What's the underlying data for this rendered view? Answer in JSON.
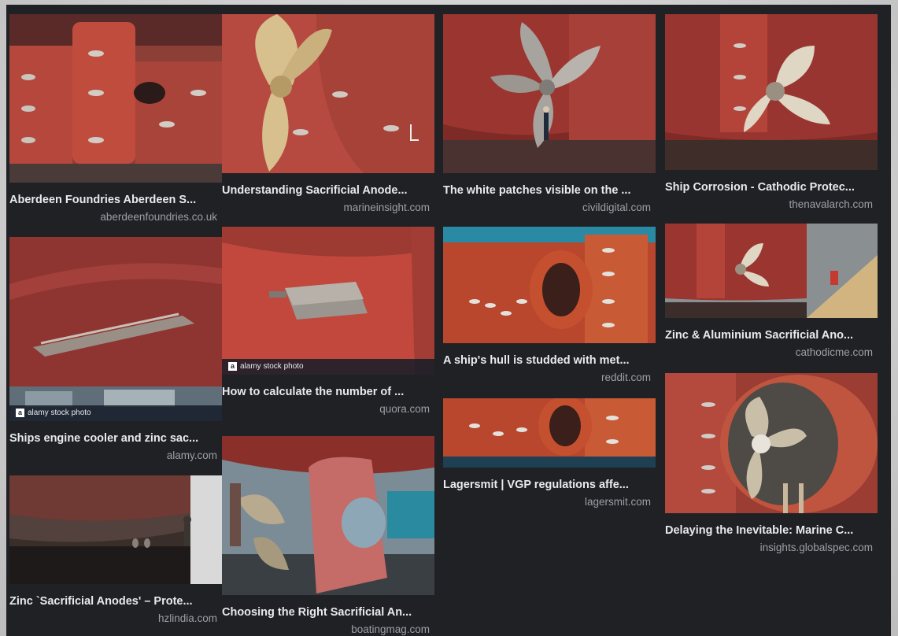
{
  "results": [
    {
      "caption": "Aberdeen Foundries Aberdeen S...",
      "source": "aberdeenfoundries.co.uk",
      "icon": "image-rudder-anodes"
    },
    {
      "caption": "Ships engine cooler and zinc sac...",
      "source": "alamy.com",
      "icon": "image-hull-cooler",
      "stock": "alamy stock photo"
    },
    {
      "caption": "Zinc `Sacrificial Anodes' – Prote...",
      "source": "hzlindia.com",
      "icon": "image-hull-underside"
    },
    {
      "caption": "Understanding Sacrificial Anode...",
      "source": "marineinsight.com",
      "icon": "image-propeller-gold"
    },
    {
      "caption": "How to calculate the number of ...",
      "source": "quora.com",
      "icon": "image-single-anode",
      "stock": "alamy stock photo"
    },
    {
      "caption": "Choosing the Right Sacrificial An...",
      "source": "boatingmag.com",
      "icon": "image-rudder-zinc"
    },
    {
      "caption": "The white patches visible on the ...",
      "source": "civildigital.com",
      "icon": "image-ship-stern-person"
    },
    {
      "caption": "A ship's hull is studded with met...",
      "source": "reddit.com",
      "icon": "image-nozzle-anodes"
    },
    {
      "caption": "Lagersmit | VGP regulations affe...",
      "source": "lagersmit.com",
      "icon": "image-nozzle-closeup"
    },
    {
      "caption": "Ship Corrosion - Cathodic Protec...",
      "source": "thenavalarch.com",
      "icon": "image-propeller-rudder"
    },
    {
      "caption": "Zinc & Aluminium Sacrificial Ano...",
      "source": "cathodicme.com",
      "icon": "image-stern-drydock"
    },
    {
      "caption": "Delaying the Inevitable: Marine C...",
      "source": "insights.globalspec.com",
      "icon": "image-ducted-propeller"
    }
  ],
  "colors": {
    "background": "#202124",
    "caption": "#e8eaed",
    "source": "#9aa0a6",
    "hull_red": "#b4443a"
  }
}
